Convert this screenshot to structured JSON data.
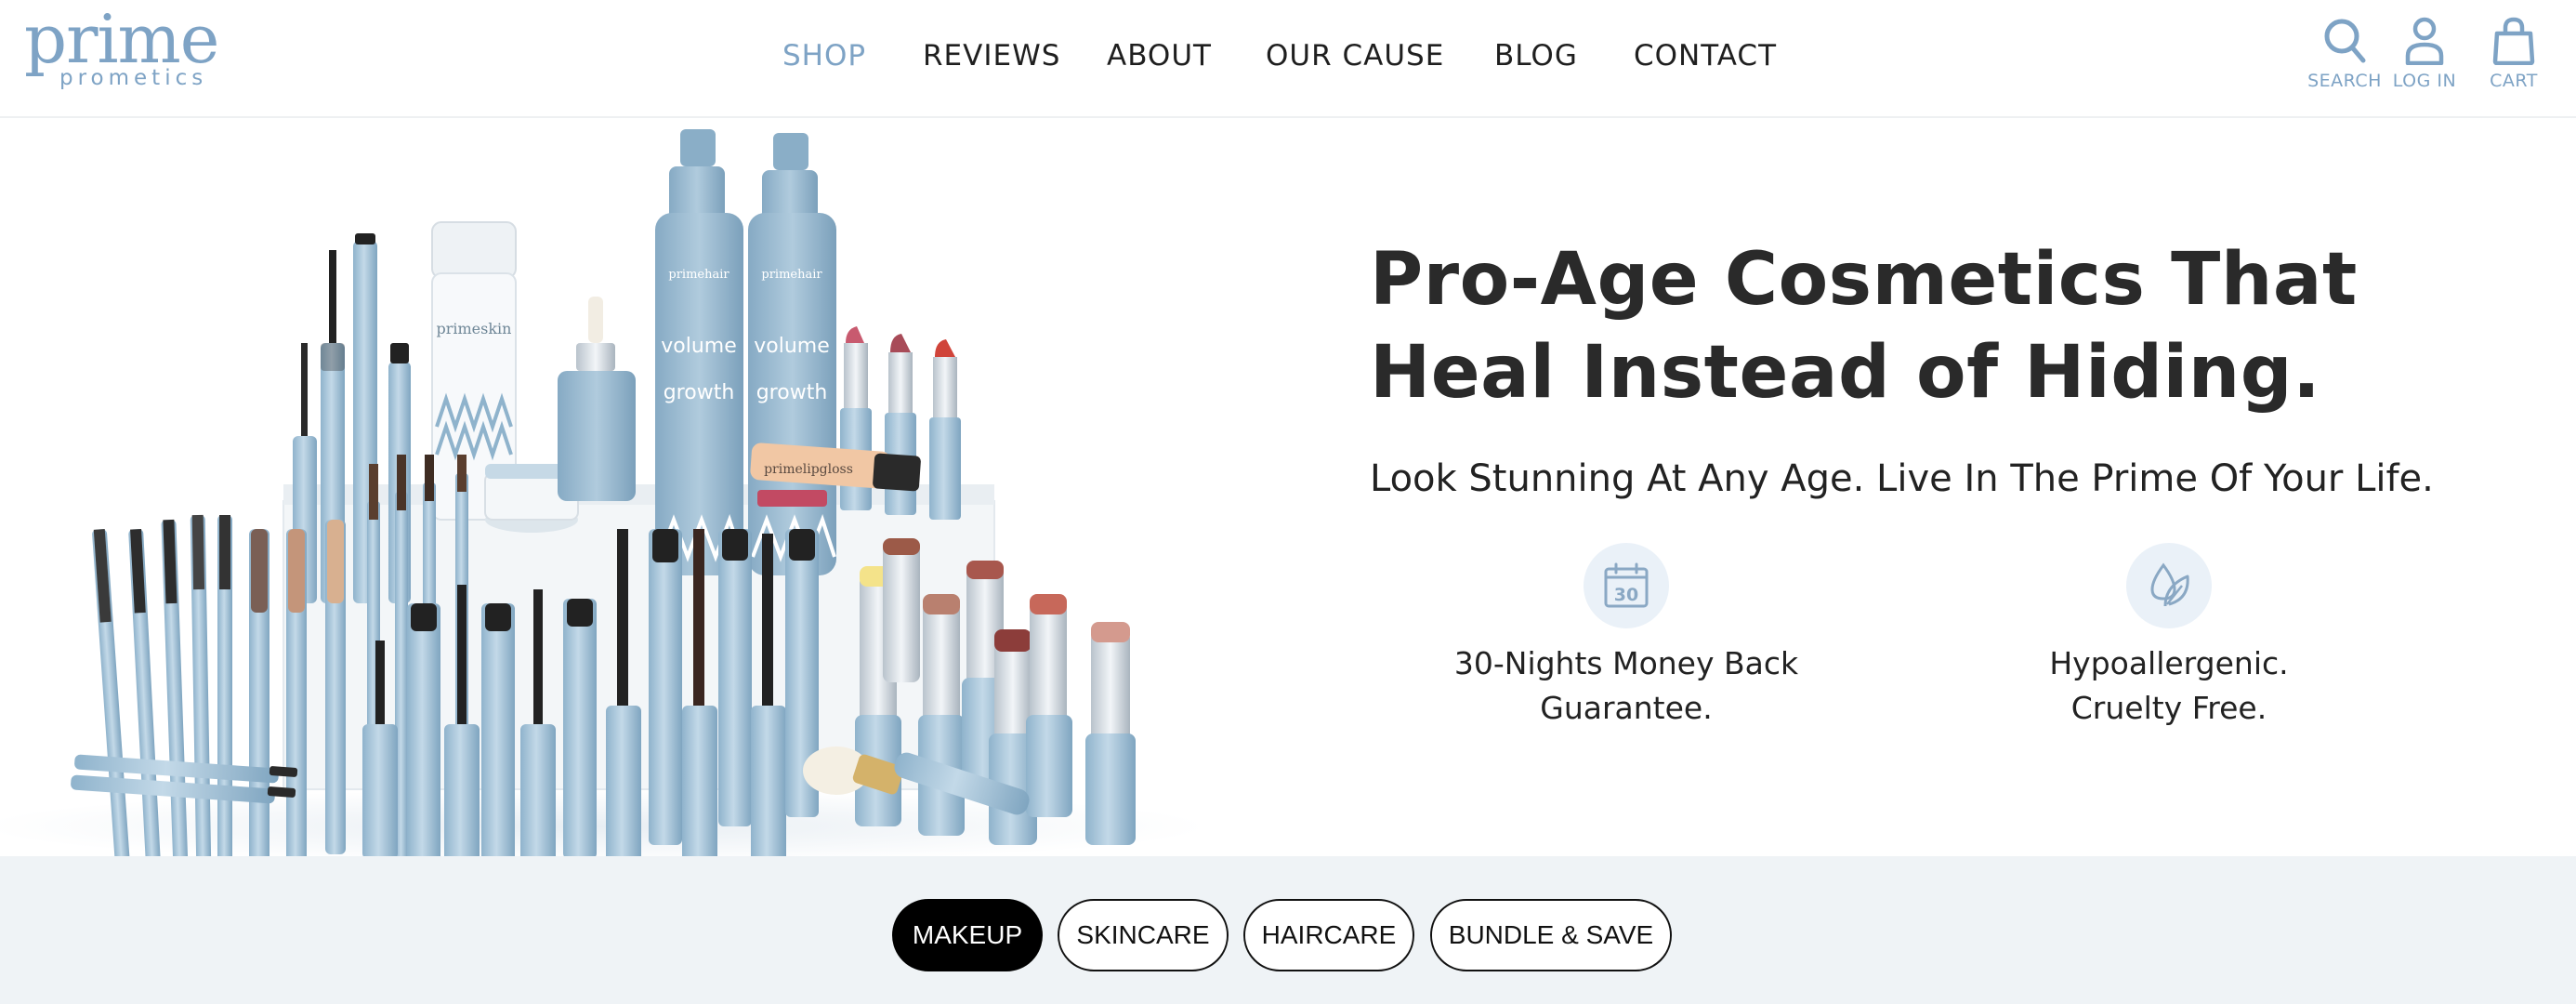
{
  "brand": {
    "logo_main": "prime",
    "logo_sub": "prometics",
    "accent_color": "#7ea3c5"
  },
  "nav": {
    "items": [
      {
        "label": "SHOP",
        "active": true
      },
      {
        "label": "REVIEWS",
        "active": false
      },
      {
        "label": "ABOUT",
        "active": false
      },
      {
        "label": "OUR CAUSE",
        "active": false
      },
      {
        "label": "BLOG",
        "active": false
      },
      {
        "label": "CONTACT",
        "active": false
      }
    ]
  },
  "utility": {
    "search": {
      "label": "SEARCH",
      "icon": "search-icon"
    },
    "login": {
      "label": "LOG IN",
      "icon": "user-icon"
    },
    "cart": {
      "label": "CART",
      "icon": "shopping-bag-icon"
    }
  },
  "hero": {
    "headline_line1": "Pro-Age Cosmetics That",
    "headline_line2": "Heal Instead of Hiding.",
    "subheadline": "Look Stunning At Any Age. Live In The Prime Of Your Life.",
    "features": [
      {
        "icon": "calendar-30-icon",
        "icon_text": "30",
        "line1": "30-Nights Money Back",
        "line2": "Guarantee."
      },
      {
        "icon": "leaf-drop-icon",
        "line1": "Hypoallergenic.",
        "line2": "Cruelty Free."
      }
    ],
    "product_labels": {
      "skin_jar": "primeskin",
      "hair_bottle": "primehair",
      "hair_bottle_text": "volume",
      "hair_bottle_text2": "growth",
      "lip_gloss": "primelipgloss"
    }
  },
  "categories": {
    "items": [
      {
        "label": "MAKEUP",
        "active": true
      },
      {
        "label": "SKINCARE",
        "active": false
      },
      {
        "label": "HAIRCARE",
        "active": false
      },
      {
        "label": "BUNDLE & SAVE",
        "active": false
      }
    ]
  }
}
